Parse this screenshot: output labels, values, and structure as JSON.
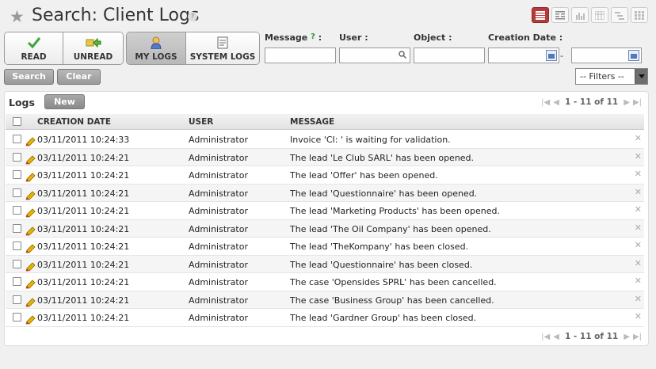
{
  "header": {
    "title": "Search: Client Logs",
    "help": "?",
    "views": [
      "list-view-icon",
      "form-view-icon",
      "graph-view-icon",
      "calendar-view-icon",
      "gantt-view-icon",
      "grid-view-icon"
    ]
  },
  "filter_buttons": [
    {
      "label": "READ",
      "icon": "check-icon"
    },
    {
      "label": "UNREAD",
      "icon": "unread-icon"
    },
    {
      "label": "MY LOGS",
      "icon": "user-icon"
    },
    {
      "label": "SYSTEM LOGS",
      "icon": "document-icon"
    }
  ],
  "search": {
    "message_label": "Message",
    "message_help": "?",
    "colon": ":",
    "user_label": "User :",
    "object_label": "Object :",
    "date_label": "Creation Date :",
    "date_sep": "-",
    "search_btn": "Search",
    "clear_btn": "Clear",
    "filters_value": "-- Filters --"
  },
  "list": {
    "title": "Logs",
    "new_btn": "New",
    "pager": "1 - 11 of 11",
    "columns": [
      "CREATION DATE",
      "USER",
      "MESSAGE"
    ],
    "rows": [
      {
        "date": "03/11/2011 10:24:33",
        "user": "Administrator",
        "message": "Invoice 'CI: ' is waiting for validation."
      },
      {
        "date": "03/11/2011 10:24:21",
        "user": "Administrator",
        "message": "The lead 'Le Club SARL' has been opened."
      },
      {
        "date": "03/11/2011 10:24:21",
        "user": "Administrator",
        "message": "The lead 'Offer' has been opened."
      },
      {
        "date": "03/11/2011 10:24:21",
        "user": "Administrator",
        "message": "The lead 'Questionnaire' has been opened."
      },
      {
        "date": "03/11/2011 10:24:21",
        "user": "Administrator",
        "message": "The lead 'Marketing Products' has been opened."
      },
      {
        "date": "03/11/2011 10:24:21",
        "user": "Administrator",
        "message": "The lead 'The Oil Company' has been opened."
      },
      {
        "date": "03/11/2011 10:24:21",
        "user": "Administrator",
        "message": "The lead 'TheKompany' has been closed."
      },
      {
        "date": "03/11/2011 10:24:21",
        "user": "Administrator",
        "message": "The lead 'Questionnaire' has been closed."
      },
      {
        "date": "03/11/2011 10:24:21",
        "user": "Administrator",
        "message": "The case 'Opensides SPRL' has been cancelled."
      },
      {
        "date": "03/11/2011 10:24:21",
        "user": "Administrator",
        "message": "The case 'Business Group' has been cancelled."
      },
      {
        "date": "03/11/2011 10:24:21",
        "user": "Administrator",
        "message": "The lead 'Gardner Group' has been closed."
      }
    ]
  }
}
